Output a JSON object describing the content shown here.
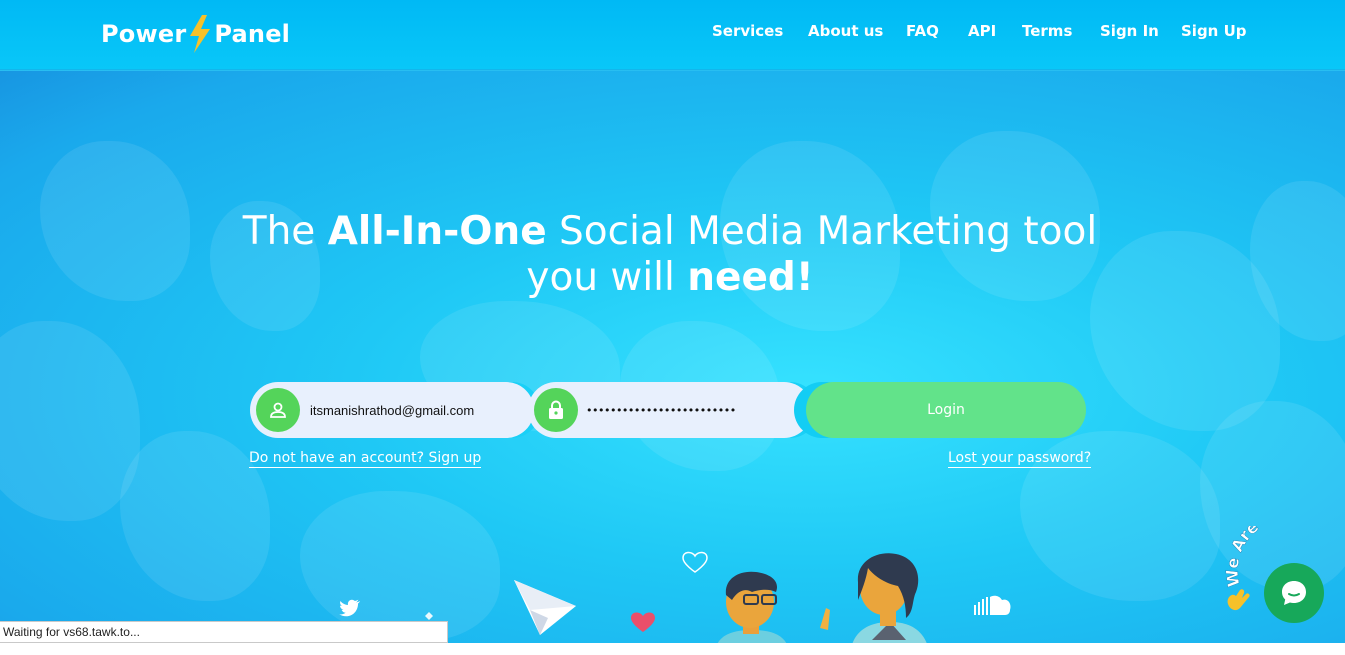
{
  "header": {
    "logo": {
      "left": "Power",
      "right": "Panel"
    },
    "nav": [
      "Services",
      "About us",
      "FAQ",
      "API",
      "Terms",
      "Sign In",
      "Sign Up"
    ]
  },
  "hero": {
    "line1_pre": "The ",
    "line1_bold": "All-In-One",
    "line1_post": " Social Media Marketing tool",
    "line2_pre": "you will ",
    "line2_bold": "need!"
  },
  "login": {
    "email_value": "itsmanishrathod@gmail.com",
    "password_value": "•••••••••••••••••••••••••",
    "button_label": "Login",
    "signup_link": "Do not have an account? Sign up",
    "lost_password_link": "Lost your password?"
  },
  "chat": {
    "badge_text": "We Are Here!"
  },
  "status_bar": {
    "text": "Waiting for vs68.tawk.to..."
  },
  "colors": {
    "accent_green": "#54d45a",
    "login_green": "#62e38a",
    "chat_green": "#17a85a",
    "header_blue": "#00b9f5"
  }
}
